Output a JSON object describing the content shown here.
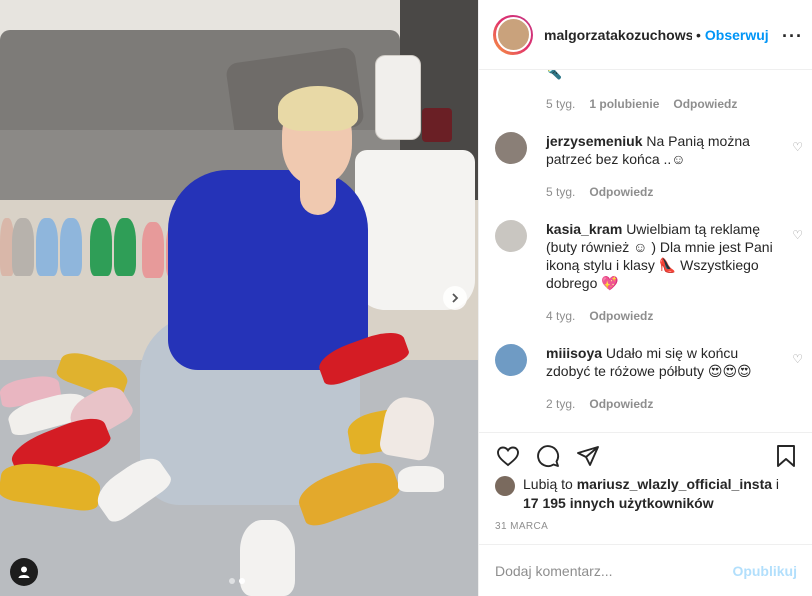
{
  "post": {
    "author": "malgorzatakozuchowska",
    "follow_label": "Obserwuj",
    "follow_dot": "•",
    "more_glyph": "···"
  },
  "photo": {
    "icons": {
      "next": "chevron-right-icon",
      "tag": "user-tag-icon"
    },
    "carousel": {
      "count": 2,
      "active": 1
    }
  },
  "top_comment_tail": {
    "emoji": "🔦",
    "time": "5 tyg.",
    "likes": "1 polubienie",
    "reply": "Odpowiedz"
  },
  "comments": [
    {
      "user": "jerzysemeniuk",
      "text": "Na Panią można patrzeć bez końca ..☺",
      "time": "5 tyg.",
      "reply": "Odpowiedz",
      "avatar_color": "#8a7f77"
    },
    {
      "user": "kasia_kram",
      "text": "Uwielbiam tą reklamę (buty również ☺ ) Dla mnie jest Pani ikoną stylu i klasy 👠 Wszystkiego dobrego 💖",
      "time": "4 tyg.",
      "reply": "Odpowiedz",
      "avatar_color": "#c9c6c1"
    },
    {
      "user": "miiisoya",
      "text": "Udało mi się w końcu zdobyć te różowe półbuty 😍😍😍",
      "time": "2 tyg.",
      "reply": "Odpowiedz",
      "avatar_color": "#6f9bc4"
    }
  ],
  "actions": {
    "icons": [
      "heart-icon",
      "comment-icon",
      "share-icon",
      "bookmark-icon"
    ]
  },
  "likes": {
    "prefix": "Lubią to ",
    "user": "mariusz_wlazly_official_insta",
    "mid": " i ",
    "count": "17 195 innych użytkowników"
  },
  "date": "31 MARCA",
  "add_comment": {
    "placeholder": "Dodaj komentarz...",
    "publish_label": "Opublikuj"
  },
  "colors": {
    "accent": "#0095f6",
    "publish_disabled": "#b2dffc",
    "muted": "#8e8e8e",
    "text": "#262626",
    "border": "#efefef",
    "sweater": "#2533b8"
  }
}
